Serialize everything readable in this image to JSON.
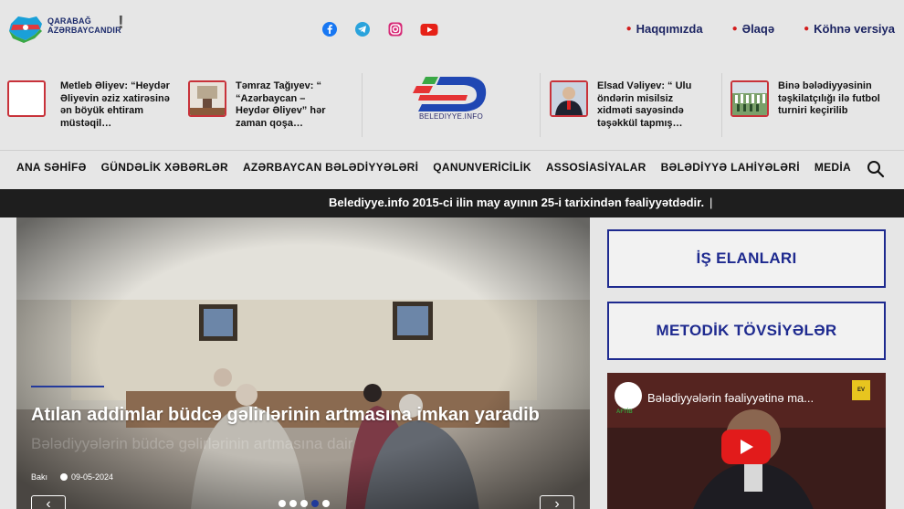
{
  "header": {
    "logo_line1": "QARABAĞ",
    "logo_line2": "AZƏRBAYCANDIR",
    "logo_excl": "!",
    "socials": [
      "facebook-icon",
      "telegram-icon",
      "instagram-icon",
      "youtube-icon"
    ],
    "links": [
      {
        "label": "Haqqımızda"
      },
      {
        "label": "Əlaqə"
      },
      {
        "label": "Köhnə versiya"
      }
    ]
  },
  "news_strip": [
    {
      "text": "Metleb Əliyev: “Heydər Əliyevin əziz xatirəsinə ən böyük ehtiram müstəqil…"
    },
    {
      "text": "Təmraz Tağıyev: “ “Azərbaycan – Heydər Əliyev” hər zaman qoşa…"
    },
    {
      "text": "Elsad Vəliyev: “ Ulu öndərin misilsiz xidməti sayəsində təşəkkül  tapmış…"
    },
    {
      "text": "Binə bələdiyyəsinin təşkilatçılığı ilə futbol turniri keçirilib"
    }
  ],
  "center_logo": {
    "text": "BELEDIYYE.INFO"
  },
  "nav": {
    "items": [
      "ANA SƏHİFƏ",
      "GÜNDƏLİK XƏBƏRLƏR",
      "AZƏRBAYCAN BƏLƏDİYYƏLƏRİ",
      "QANUNVERİCİLİK",
      "ASSOSİASİYALAR",
      "BƏLƏDİYYƏ LAHİYƏLƏRİ",
      "MEDİA"
    ]
  },
  "ticker": {
    "text": "Belediyye.info 2015-ci ilin may ayının 25-i tarixindən fəaliyyətdədir.",
    "cursor": "|"
  },
  "slider": {
    "title": "Atılan addimlar büdcə gəlirlərinin  artmasına imkan yaradib",
    "ghost": "Bələdiyyələrin büdcə gəlirlərinin artmasına dair",
    "location": "Bakı",
    "date": "09-05-2024",
    "prev": "‹",
    "next": "›",
    "dots": 5,
    "active_dot": 3
  },
  "right": {
    "box1": "İŞ ELANLARI",
    "box2": "METODİK TÖVSİYƏLƏR",
    "video_title": "Bələdiyyələrin fəaliyyətinə ma...",
    "video_logo": "AFTİB",
    "video_badge": "ЕV"
  }
}
